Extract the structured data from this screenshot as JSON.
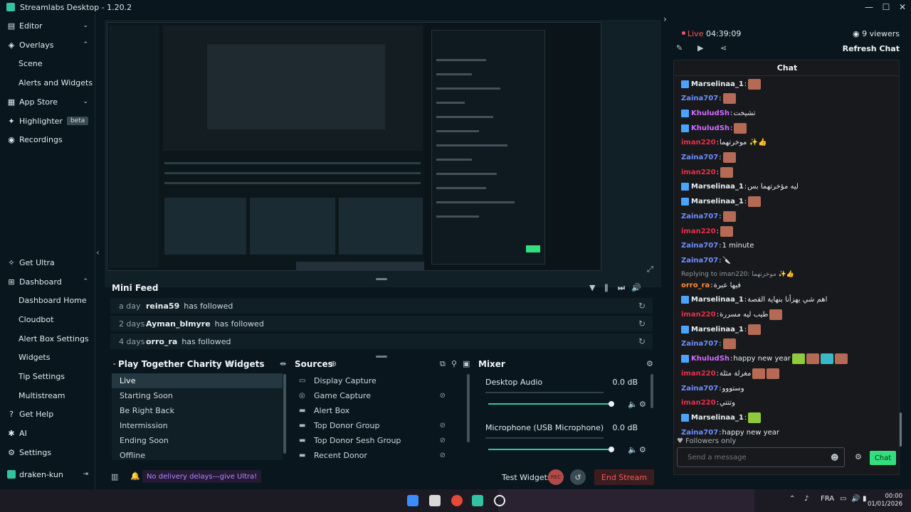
{
  "window": {
    "title": "Streamlabs Desktop - 1.20.2",
    "minimize": "—",
    "maximize": "☐",
    "close": "✕"
  },
  "sidebar": {
    "items": [
      {
        "label": "Editor",
        "icon": "editor-icon",
        "expandable": true
      },
      {
        "label": "Overlays",
        "icon": "overlays-icon",
        "expandable": true
      },
      {
        "label": "Scene",
        "sub": true
      },
      {
        "label": "Alerts and Widgets",
        "sub": true
      },
      {
        "label": "App Store",
        "icon": "app-store-icon",
        "expandable": true
      },
      {
        "label": "Highlighter",
        "icon": "highlighter-icon",
        "badge": "beta"
      },
      {
        "label": "Recordings",
        "icon": "recordings-icon"
      }
    ],
    "bottom_items": [
      {
        "label": "Get Ultra",
        "icon": "ultra-icon"
      },
      {
        "label": "Dashboard",
        "icon": "dashboard-icon",
        "expandable": true
      },
      {
        "label": "Dashboard Home",
        "sub": true
      },
      {
        "label": "Cloudbot",
        "sub": true
      },
      {
        "label": "Alert Box Settings",
        "sub": true
      },
      {
        "label": "Widgets",
        "sub": true
      },
      {
        "label": "Tip Settings",
        "sub": true
      },
      {
        "label": "Multistream",
        "sub": true
      },
      {
        "label": "Get Help",
        "icon": "help-icon"
      },
      {
        "label": "AI",
        "icon": "ai-icon"
      },
      {
        "label": "Settings",
        "icon": "settings-icon"
      }
    ],
    "user": "draken-kun"
  },
  "mini_feed": {
    "title": "Mini Feed",
    "rows": [
      {
        "ago": "a day",
        "who": "reina59",
        "what": "has followed"
      },
      {
        "ago": "2 days",
        "who": "Ayman_blmyre",
        "what": "has followed"
      },
      {
        "ago": "4 days",
        "who": "orro_ra",
        "what": "has followed"
      }
    ]
  },
  "scenes": {
    "title": "Play Together Charity Widgets",
    "items": [
      "Live",
      "Starting Soon",
      "Be Right Back",
      "Intermission",
      "Ending Soon",
      "Offline"
    ],
    "active": "Live"
  },
  "sources": {
    "title": "Sources",
    "items": [
      {
        "label": "Display Capture",
        "icon": "monitor-icon",
        "hidden": false
      },
      {
        "label": "Game Capture",
        "icon": "gamepad-icon",
        "hidden": true
      },
      {
        "label": "Alert Box",
        "icon": "folder-icon",
        "hidden": false
      },
      {
        "label": "Top Donor Group",
        "icon": "folder-icon",
        "hidden": true
      },
      {
        "label": "Top Donor Sesh Group",
        "icon": "folder-icon",
        "hidden": true
      },
      {
        "label": "Recent Donor",
        "icon": "folder-icon",
        "hidden": true
      }
    ]
  },
  "mixer": {
    "title": "Mixer",
    "channels": [
      {
        "name": "Desktop Audio",
        "db": "0.0 dB",
        "level": 0.97
      },
      {
        "name": "Microphone (USB Microphone)",
        "db": "0.0 dB",
        "level": 0.97
      }
    ]
  },
  "status": {
    "ultra_promo": "No delivery delays—give Ultra!",
    "test_widgets": "Test Widgets",
    "rec": "REC",
    "end_stream": "End Stream"
  },
  "chat_panel": {
    "live_label": "Live",
    "live_time": "04:39:09",
    "viewers": "9 viewers",
    "refresh": "Refresh Chat",
    "chat_title": "Chat",
    "followers_only": "Followers only",
    "send_placeholder": "Send a message",
    "chat_button": "Chat",
    "messages": [
      {
        "user": "Marselinaa_1",
        "color": "white",
        "badge": true,
        "text": "",
        "emotes": [
          "face"
        ]
      },
      {
        "user": "Zaina707",
        "color": "blue",
        "badge": false,
        "text": "",
        "emotes": [
          "face"
        ]
      },
      {
        "user": "KhuludSh",
        "color": "purple",
        "badge": true,
        "text": "تشيخت",
        "emotes": []
      },
      {
        "user": "KhuludSh",
        "color": "purple",
        "badge": true,
        "text": "",
        "emotes": [
          "face"
        ]
      },
      {
        "user": "iman220",
        "color": "red",
        "badge": false,
        "text": "موخرتهما ✨👍",
        "emotes": []
      },
      {
        "user": "Zaina707",
        "color": "blue",
        "badge": false,
        "text": "",
        "emotes": [
          "face"
        ]
      },
      {
        "user": "iman220",
        "color": "red",
        "badge": false,
        "text": "",
        "emotes": [
          "face"
        ]
      },
      {
        "user": "Marselinaa_1",
        "color": "white",
        "badge": true,
        "text": "ليه مؤخرتهما بس",
        "emotes": []
      },
      {
        "user": "Marselinaa_1",
        "color": "white",
        "badge": true,
        "text": "",
        "emotes": [
          "face"
        ]
      },
      {
        "user": "Zaina707",
        "color": "blue",
        "badge": false,
        "text": "",
        "emotes": [
          "face"
        ]
      },
      {
        "user": "iman220",
        "color": "red",
        "badge": false,
        "text": "",
        "emotes": [
          "face"
        ]
      },
      {
        "user": "Zaina707",
        "color": "blue",
        "badge": false,
        "text": "1 minute",
        "emotes": []
      },
      {
        "user": "Zaina707",
        "color": "blue",
        "badge": false,
        "text": "🔪",
        "emotes": []
      },
      {
        "reply": "Replying to iman220: موخرتهما ✨👍"
      },
      {
        "user": "orro_ra",
        "color": "orange",
        "badge": false,
        "text": "فيها عبرة",
        "emotes": []
      },
      {
        "user": "Marselinaa_1",
        "color": "white",
        "badge": true,
        "text": "اهم شي يهزأنا بنهاية القصة",
        "emotes": []
      },
      {
        "user": "iman220",
        "color": "red",
        "badge": false,
        "text": "طيب ليه مسررة",
        "emotes": [
          "face"
        ]
      },
      {
        "user": "Marselinaa_1",
        "color": "white",
        "badge": true,
        "text": "",
        "emotes": [
          "face"
        ]
      },
      {
        "user": "Zaina707",
        "color": "blue",
        "badge": false,
        "text": "",
        "emotes": [
          "face"
        ]
      },
      {
        "user": "KhuludSh",
        "color": "purple",
        "badge": true,
        "text": "happy new year",
        "emotes": [
          "car",
          "face",
          "cat",
          "face"
        ]
      },
      {
        "user": "iman220",
        "color": "red",
        "badge": false,
        "text": "مغرلة مثلة",
        "emotes": [
          "face",
          "face"
        ]
      },
      {
        "user": "Zaina707",
        "color": "blue",
        "badge": false,
        "text": "وستووو",
        "emotes": []
      },
      {
        "user": "iman220",
        "color": "red",
        "badge": false,
        "text": "وتتتي",
        "emotes": []
      },
      {
        "user": "Marselinaa_1",
        "color": "white",
        "badge": true,
        "text": "",
        "emotes": [
          "car"
        ]
      },
      {
        "user": "Zaina707",
        "color": "blue",
        "badge": false,
        "text": "happy new year",
        "emotes": []
      }
    ]
  },
  "taskbar": {
    "lang": "FRA",
    "time": "00:00",
    "date": "01/01/2026"
  },
  "colors": {
    "accent": "#31c3a2",
    "live": "#f05a5a",
    "chat_button": "#31e07d"
  }
}
